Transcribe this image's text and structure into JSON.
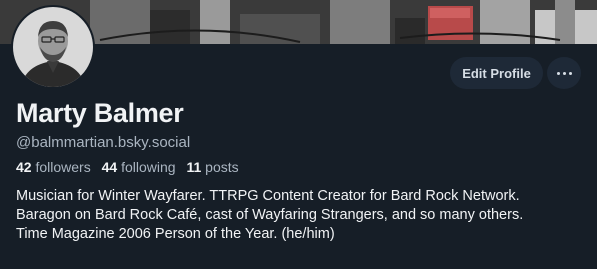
{
  "profile": {
    "display_name": "Marty Balmer",
    "handle": "@balmmartian.bsky.social",
    "stats": {
      "followers_count": "42",
      "followers_label": "followers",
      "following_count": "44",
      "following_label": "following",
      "posts_count": "11",
      "posts_label": "posts"
    },
    "bio_lines": [
      "Musician for Winter Wayfarer. TTRPG Content Creator for Bard Rock Network.",
      "Baragon on Bard Rock Café, cast of Wayfaring Strangers, and so many others.",
      "Time Magazine 2006 Person of the Year. (he/him)"
    ]
  },
  "actions": {
    "edit_profile_label": "Edit Profile",
    "more_icon": "ellipsis-icon"
  },
  "colors": {
    "background": "#161e27",
    "button_bg": "#1e2937",
    "secondary_text": "#aab5c1"
  }
}
